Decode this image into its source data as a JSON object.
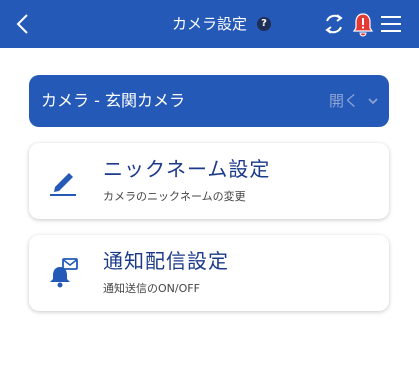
{
  "header": {
    "title": "カメラ設定",
    "help_glyph": "?",
    "bg_color": "#2459b8",
    "icons": [
      "back-arrow-icon",
      "help-icon",
      "refresh-icon",
      "alert-bell-icon",
      "menu-icon"
    ]
  },
  "camera_bar": {
    "label": "カメラ - 玄関カメラ",
    "open_label": "開く",
    "icon": "chevron-down-icon"
  },
  "cards": [
    {
      "title": "ニックネーム設定",
      "subtitle": "カメラのニックネームの変更",
      "icon": "pencil-icon"
    },
    {
      "title": "通知配信設定",
      "subtitle": "通知送信のON/OFF",
      "icon": "notification-bell-icon"
    }
  ],
  "colors": {
    "accent": "#2459b8",
    "title_text": "#1b3a8a",
    "alert": "#e53935"
  }
}
